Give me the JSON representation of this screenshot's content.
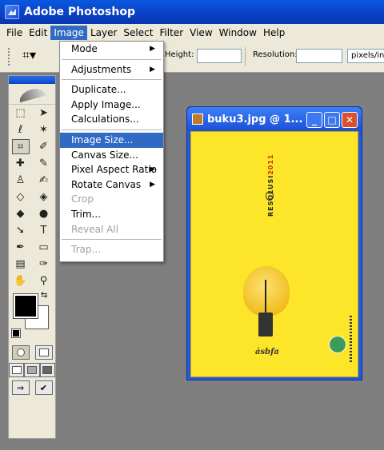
{
  "window": {
    "title": "Adobe Photoshop"
  },
  "menubar": {
    "items": [
      "File",
      "Edit",
      "Image",
      "Layer",
      "Select",
      "Filter",
      "View",
      "Window",
      "Help"
    ],
    "active": "Image"
  },
  "options": {
    "height_label": "Height:",
    "resolution_label": "Resolution:",
    "units_value": "pixels/inc"
  },
  "image_menu": {
    "items": [
      {
        "label": "Mode",
        "submenu": true
      },
      {
        "sep": true
      },
      {
        "label": "Adjustments",
        "submenu": true
      },
      {
        "sep": true
      },
      {
        "label": "Duplicate..."
      },
      {
        "label": "Apply Image..."
      },
      {
        "label": "Calculations..."
      },
      {
        "sep": true
      },
      {
        "label": "Image Size...",
        "highlighted": true
      },
      {
        "label": "Canvas Size..."
      },
      {
        "label": "Pixel Aspect Ratio",
        "submenu": true
      },
      {
        "label": "Rotate Canvas",
        "submenu": true
      },
      {
        "label": "Crop",
        "disabled": true
      },
      {
        "label": "Trim..."
      },
      {
        "label": "Reveal All",
        "disabled": true
      },
      {
        "sep": true
      },
      {
        "label": "Trap...",
        "disabled": true
      }
    ]
  },
  "document": {
    "title": "buku3.jpg @ 1...",
    "canvas_color": "#fde52a",
    "poster_text_dark": "RESOLUSI",
    "poster_text_red": "2011",
    "poster_logo": "ásbfa"
  },
  "colors": {
    "accent": "#316ac5",
    "titlebar": "#0a46d0",
    "foreground": "#000000",
    "background": "#ffffff"
  },
  "tools": [
    [
      "marquee-tool",
      "move-tool"
    ],
    [
      "lasso-tool",
      "magic-wand-tool"
    ],
    [
      "crop-tool",
      "slice-tool"
    ],
    [
      "healing-brush-tool",
      "brush-tool"
    ],
    [
      "clone-stamp-tool",
      "history-brush-tool"
    ],
    [
      "eraser-tool",
      "paint-bucket-tool"
    ],
    [
      "blur-tool",
      "dodge-tool"
    ],
    [
      "path-selection-tool",
      "type-tool"
    ],
    [
      "pen-tool",
      "rectangle-tool"
    ],
    [
      "notes-tool",
      "eyedropper-tool"
    ],
    [
      "hand-tool",
      "zoom-tool"
    ]
  ]
}
